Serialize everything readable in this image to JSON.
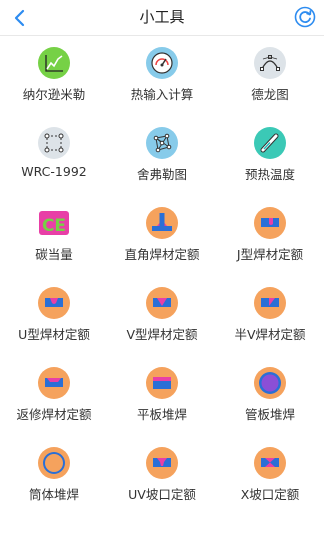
{
  "header": {
    "title": "小工具"
  },
  "colors": {
    "accent": "#2d8cf0",
    "orange": "#f5a25d",
    "blue": "#2a6fd6",
    "magenta": "#e83fa6",
    "green": "#76d146",
    "teal": "#3bc9b6",
    "sky": "#87cbea"
  },
  "tools": [
    {
      "label": "纳尔逊米勒",
      "icon": "line-chart-icon"
    },
    {
      "label": "热输入计算",
      "icon": "gauge-icon"
    },
    {
      "label": "德龙图",
      "icon": "bezier-curve-icon"
    },
    {
      "label": "WRC-1992",
      "icon": "dotted-square-icon"
    },
    {
      "label": "舍弗勒图",
      "icon": "network-graph-icon"
    },
    {
      "label": "预热温度",
      "icon": "thermometer-icon"
    },
    {
      "label": "碳当量",
      "icon": "ce-badge-icon"
    },
    {
      "label": "直角焊材定额",
      "icon": "t-joint-weld-icon"
    },
    {
      "label": "J型焊材定额",
      "icon": "j-groove-weld-icon"
    },
    {
      "label": "U型焊材定额",
      "icon": "u-groove-weld-icon"
    },
    {
      "label": "V型焊材定额",
      "icon": "v-groove-weld-icon"
    },
    {
      "label": "半V焊材定额",
      "icon": "half-v-groove-weld-icon"
    },
    {
      "label": "返修焊材定额",
      "icon": "repair-weld-icon"
    },
    {
      "label": "平板堆焊",
      "icon": "flat-plate-overlay-icon"
    },
    {
      "label": "管板堆焊",
      "icon": "tube-plate-overlay-icon"
    },
    {
      "label": "筒体堆焊",
      "icon": "cylinder-overlay-icon"
    },
    {
      "label": "UV坡口定额",
      "icon": "uv-groove-icon"
    },
    {
      "label": "X坡口定额",
      "icon": "x-groove-icon"
    }
  ]
}
